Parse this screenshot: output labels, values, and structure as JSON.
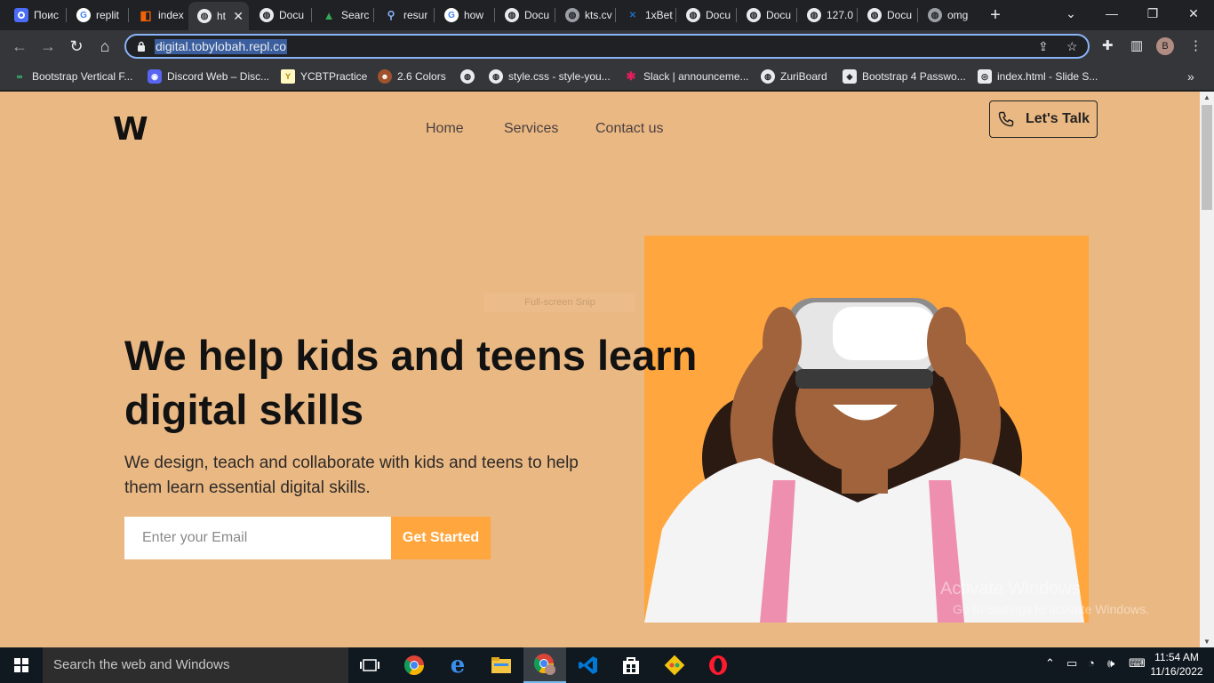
{
  "browser": {
    "tabs": [
      {
        "title": "Поис"
      },
      {
        "title": "replit"
      },
      {
        "title": "index"
      },
      {
        "title": "ht"
      },
      {
        "title": "Docu"
      },
      {
        "title": "Searc"
      },
      {
        "title": "resur"
      },
      {
        "title": "how"
      },
      {
        "title": "Docu"
      },
      {
        "title": "kts.cv"
      },
      {
        "title": "1xBet"
      },
      {
        "title": "Docu"
      },
      {
        "title": "Docu"
      },
      {
        "title": "127.0"
      },
      {
        "title": "Docu"
      },
      {
        "title": "omg"
      }
    ],
    "new_tab": "+",
    "url": "digital.tobylobah.repl.co",
    "profile_initial": "B",
    "bookmarks": [
      {
        "label": "Bootstrap Vertical F..."
      },
      {
        "label": "Discord Web – Disc..."
      },
      {
        "label": "YCBTPractice"
      },
      {
        "label": "2.6 Colors"
      },
      {
        "label": ""
      },
      {
        "label": "style.css - style-you..."
      },
      {
        "label": "Slack | announceme..."
      },
      {
        "label": "ZuriBoard"
      },
      {
        "label": "Bootstrap 4 Passwo..."
      },
      {
        "label": "index.html - Slide S..."
      }
    ]
  },
  "site": {
    "logo": "W",
    "nav": [
      "Home",
      "Services",
      "Contact us"
    ],
    "cta_label": "Let's Talk",
    "hero_title_line1": "We help kids and teens learn",
    "hero_title_line2": "digital skills",
    "hero_subtitle": "We design, teach and collaborate with kids and teens to help them learn essential digital skills.",
    "email_placeholder": "Enter your Email",
    "get_started": "Get Started",
    "snip_label": "Full-screen Snip",
    "watermark_title": "Activate Windows",
    "watermark_sub": "Go to Settings to activate Windows.",
    "colors": {
      "page_bg": "#eab883",
      "accent": "#ffa63e",
      "text": "#121212"
    }
  },
  "taskbar": {
    "search_placeholder": "Search the web and Windows",
    "time": "11:54 AM",
    "date": "11/16/2022"
  }
}
